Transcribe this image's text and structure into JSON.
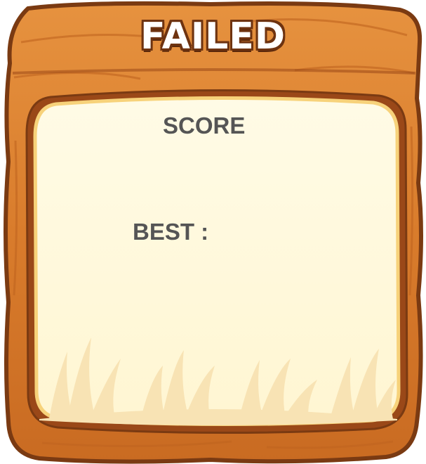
{
  "dialog": {
    "title": "FAILED",
    "score_label": "SCORE",
    "best_label": "BEST :"
  },
  "colors": {
    "wood_light": "#e08a3a",
    "wood_dark": "#b85a1e",
    "wood_outline": "#7a3a12",
    "panel_fill": "#fff8dc",
    "panel_border": "#f7d27a",
    "grass": "#f8e3b4",
    "text": "#555555",
    "title_text": "#ffffff",
    "title_outline": "#6e3310"
  },
  "icons": {
    "background_decoration": "grass-icon"
  }
}
